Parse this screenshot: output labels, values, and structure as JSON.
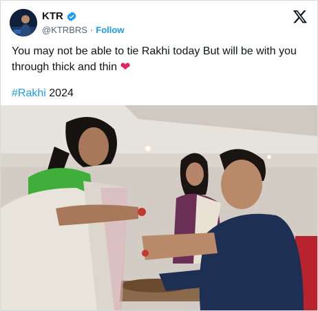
{
  "tweet": {
    "author": {
      "name": "KTR",
      "handle": "@KTRBRS",
      "separator": "·",
      "follow_label": "Follow"
    },
    "text": "You may not be able to tie Rakhi today But will be with you through thick and thin",
    "emoji": "❤",
    "hashtag": "#Rakhi",
    "hashtag_suffix": "2024"
  },
  "colors": {
    "accent": "#1d9bf0",
    "text": "#0f1419",
    "muted": "#536471",
    "heart": "#e0245e"
  },
  "icons": {
    "verified": "verified-badge-icon",
    "logo": "x-logo-icon"
  }
}
